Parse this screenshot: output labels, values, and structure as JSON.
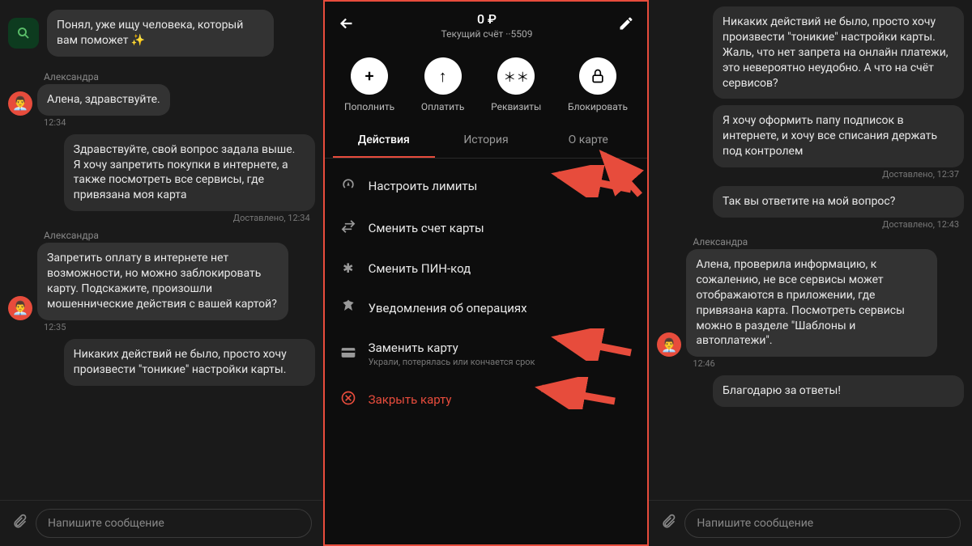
{
  "left": {
    "botMessage": "Понял, уже ищу человека, который вам поможет ✨",
    "senderName": "Александра",
    "messages": [
      {
        "type": "in",
        "withAvatar": true,
        "text": "Алена, здравствуйте.",
        "time": "12:34"
      },
      {
        "type": "out",
        "text": "Здравствуйте,  свой вопрос задала выше. Я хочу запретить покупки в интернете, а также посмотреть все сервисы, где привязана моя карта",
        "delivered": "Доставлено, 12:34"
      },
      {
        "type": "in",
        "sender": "Александра",
        "withAvatar": true,
        "text": "Запретить оплату в интернете нет возможности, но можно заблокировать карту. Подскажите, произошли мошеннические действия с вашей картой?",
        "time": "12:35"
      },
      {
        "type": "out",
        "text": "Никаких действий не было, просто хочу произвести \"тоникие\" настройки карты."
      }
    ],
    "inputPlaceholder": "Напишите сообщение"
  },
  "mid": {
    "balance": "0 ₽",
    "account": "Текущий счёт ··5509",
    "actions": [
      {
        "icon": "+",
        "label": "Пополнить"
      },
      {
        "icon": "↑",
        "label": "Оплатить"
      },
      {
        "icon": "**",
        "label": "Реквизиты"
      },
      {
        "icon": "lock",
        "label": "Блокировать"
      }
    ],
    "tabs": [
      {
        "label": "Действия",
        "active": true
      },
      {
        "label": "История",
        "active": false
      },
      {
        "label": "О карте",
        "active": false
      }
    ],
    "options": [
      {
        "icon": "gauge",
        "text": "Настроить лимиты"
      },
      {
        "icon": "swap",
        "text": "Сменить счет карты"
      },
      {
        "icon": "asterisk",
        "text": "Сменить ПИН-код"
      },
      {
        "icon": "bell",
        "text": "Уведомления об операциях"
      },
      {
        "icon": "card",
        "text": "Заменить карту",
        "sub": "Украли, потерялась или кончается срок"
      },
      {
        "icon": "close",
        "text": "Закрыть карту",
        "danger": true
      }
    ]
  },
  "right": {
    "messages": [
      {
        "type": "out",
        "text": "Никаких действий не было, просто хочу произвести \"тоникие\" настройки карты. Жаль, что нет запрета на онлайн платежи, это невероятно неудобно. А что на счёт сервисов?"
      },
      {
        "type": "out",
        "text": "Я хочу оформить папу подписок в интернете, и хочу все списания держать под контролем",
        "delivered": "Доставлено, 12:37"
      },
      {
        "type": "out",
        "text": "Так вы ответите на мой вопрос?",
        "delivered": "Доставлено, 12:43"
      },
      {
        "type": "in",
        "sender": "Александра",
        "withAvatar": true,
        "text": "Алена, проверила информацию, к сожалению, не все сервисы может отображаются в приложении, где привязана карта. Посмотреть сервисы можно в разделе \"Шаблоны и автоплатежи\".",
        "time": "12:46"
      },
      {
        "type": "out",
        "text": "Благодарю за ответы!"
      }
    ],
    "inputPlaceholder": "Напишите сообщение"
  }
}
